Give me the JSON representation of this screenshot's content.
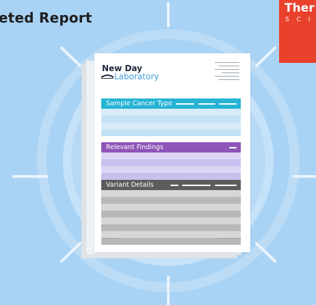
{
  "page": {
    "heading": "eted Report",
    "brand": {
      "line1": "Ther",
      "line2": "S C I E"
    }
  },
  "report": {
    "lab_name_line1": "New Day",
    "lab_name_line2": "Laboratory",
    "sections": [
      {
        "title": "Sample Cancer Type",
        "color": "#26b3d4",
        "row_colors": [
          "#d7ecf8",
          "#c3e1f4"
        ]
      },
      {
        "title": "Relevant Findings",
        "color": "#8f54b8",
        "row_colors": [
          "#dcd6f4",
          "#c9c0ef"
        ]
      },
      {
        "title": "Variant Details",
        "color": "#5c5c5c",
        "row_colors": [
          "#d7d7d7",
          "#b8b8b8"
        ]
      }
    ]
  },
  "colors": {
    "background": "#a9d3f5",
    "ring": "#c0def7",
    "accent_red": "#e8412c"
  }
}
